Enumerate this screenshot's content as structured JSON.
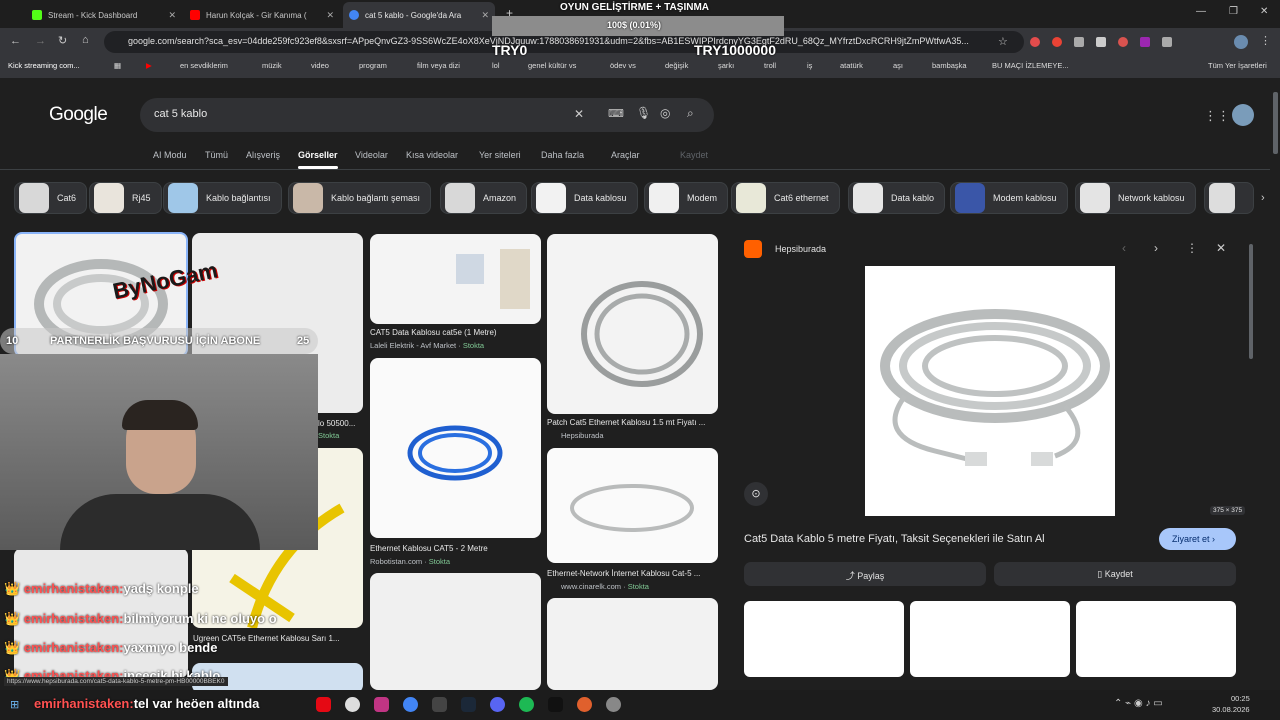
{
  "tabs": [
    {
      "label": "Stream - Kick Dashboard",
      "color": "#53fc18"
    },
    {
      "label": "Harun Kolçak - Gir Kanıma (",
      "color": "#ff0000"
    },
    {
      "label": "cat 5 kablo - Google'da Ara",
      "color": "#4285f4"
    }
  ],
  "address": "google.com/search?sca_esv=04dde259fc923ef8&sxsrf=APpeQnvGZ3-9SS6WcZE4oX8XeVjNDJquuw:1788038691931&udm=2&fbs=AB1ESWIPPIrdcnyYG3EgtF2dRU_68Qz_MYfrztDxcRCRH9jtZmPWtfwA35...",
  "bookmarks": [
    "Kick streaming com...",
    "en sevdiklerim",
    "müzik",
    "video",
    "program",
    "film veya dizi",
    "lol",
    "genel kültür vs",
    "ödev vs",
    "değişik",
    "şarkı",
    "troll",
    "iş",
    "atatürk",
    "aşı",
    "bambaşka",
    "BU MAÇI İZLEMEYE...",
    "Tüm Yer İşaretleri"
  ],
  "search": {
    "logo": "Google",
    "query": "cat 5 kablo"
  },
  "nav": [
    "AI Modu",
    "Tümü",
    "Alışveriş",
    "Görseller",
    "Videolar",
    "Kısa videolar",
    "Yer siteleri",
    "Daha fazla",
    "Araçlar",
    "Kaydet"
  ],
  "chips": [
    "Cat6",
    "Rj45",
    "Kablo bağlantısı",
    "Kablo bağlantı şeması",
    "Amazon",
    "Data kablosu",
    "Modem",
    "Cat6 ethernet",
    "Data kablo",
    "Modem kablosu",
    "Network kablosu"
  ],
  "results": {
    "c3a": {
      "caption": "CAT5 Data Kablosu cat5e (1 Metre)",
      "src": "Laleli Elektrik - Avf Market",
      "stock": "Stokta"
    },
    "c4a": {
      "caption": "Patch Cat5 Ethernet Kablosu 1.5 mt Fiyatı ...",
      "src": "Hepsiburada"
    },
    "c3b": {
      "caption": "Ethernet Kablosu CAT5 - 2 Metre",
      "src": "Robotistan.com",
      "stock": "Stokta"
    },
    "c4b": {
      "caption": "Ethernet-Network İnternet Kablosu Cat-5 ...",
      "src": "www.cinarelk.com",
      "stock": "Stokta"
    },
    "c2a_partial": "lo 50500...",
    "c2a_stock": "Stokta",
    "c2b": {
      "caption": "Ugreen CAT5e Ethernet Kablosu Sarı 1..."
    }
  },
  "preview": {
    "site": "Hepsiburada",
    "title": "Cat5 Data Kablo 5 metre Fiyatı, Taksit Seçenekleri ile Satın Al",
    "visit": "Ziyaret et",
    "share": "Paylaş",
    "save": "Kaydet",
    "dims": "375 × 375"
  },
  "stream_overlay": {
    "goal_title": "OYUN GELİŞTİRME + TAŞINMA",
    "goal_progress": "100$ (0.01%)",
    "goal_fraction": 0.0001,
    "goal_start": "TRY0",
    "goal_end": "TRY1000000",
    "watermark": "ByNoGam",
    "banner_left": "10",
    "banner_text": "PARTNERLİK BAŞVURUSU İÇİN ABONE",
    "banner_right": "25"
  },
  "chat": [
    {
      "user": "emirhanistaken:",
      "msg": "yadş konple"
    },
    {
      "user": "emirhanistaken:",
      "msg": "bilmiyorum ki ne oluyo o"
    },
    {
      "user": "emirhanistaken:",
      "msg": "yaxmıyo bende"
    },
    {
      "user": "emirhanistaken:",
      "msg": "incecik bi kablo"
    },
    {
      "user": "emirhanistaken:",
      "msg": "tel var heöen altında"
    }
  ],
  "status_url": "https://www.hepsiburada.com/cat5-data-kablo-5-metre-pm-HB00000BBEK0",
  "clock": {
    "time": "00:25",
    "date": "30.08.2026"
  }
}
